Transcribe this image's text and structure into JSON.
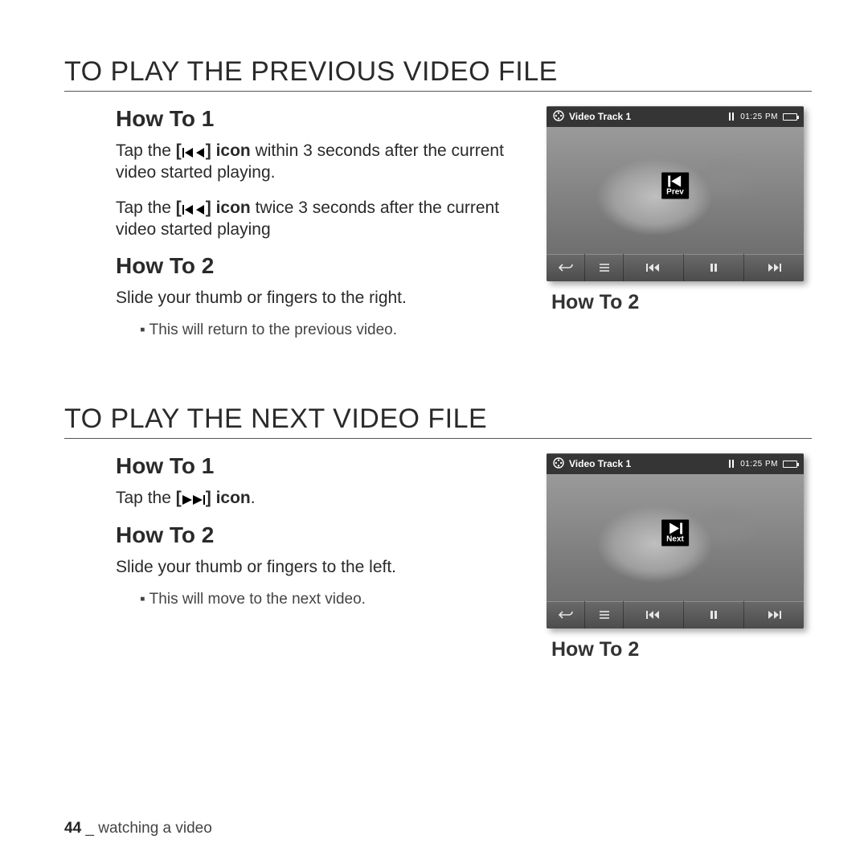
{
  "section1": {
    "title": "TO PLAY THE PREVIOUS VIDEO FILE",
    "how1_h": "How To 1",
    "how1_p1a": "Tap the ",
    "how1_p1b": " within 3 seconds after the current video started playing.",
    "how1_p2a": "Tap the ",
    "how1_p2b": " twice 3 seconds after the current video started playing",
    "icon_label": "icon",
    "how2_h": "How To 2",
    "how2_p": "Slide your thumb or fingers to the right.",
    "how2_bullet": "This will return to the previous video.",
    "fig_caption": "How To 2"
  },
  "section2": {
    "title": "TO PLAY THE NEXT VIDEO FILE",
    "how1_h": "How To 1",
    "how1_pa": "Tap the ",
    "how1_pb": ".",
    "icon_label": "icon",
    "how2_h": "How To 2",
    "how2_p": "Slide your thumb or fingers to the left.",
    "how2_bullet": "This will move to the next video.",
    "fig_caption": "How To 2"
  },
  "device": {
    "track": "Video Track 1",
    "time": "01:25 PM",
    "prev_label": "Prev",
    "next_label": "Next"
  },
  "footer": {
    "page": "44",
    "sep": " _ ",
    "section": "watching a video"
  }
}
